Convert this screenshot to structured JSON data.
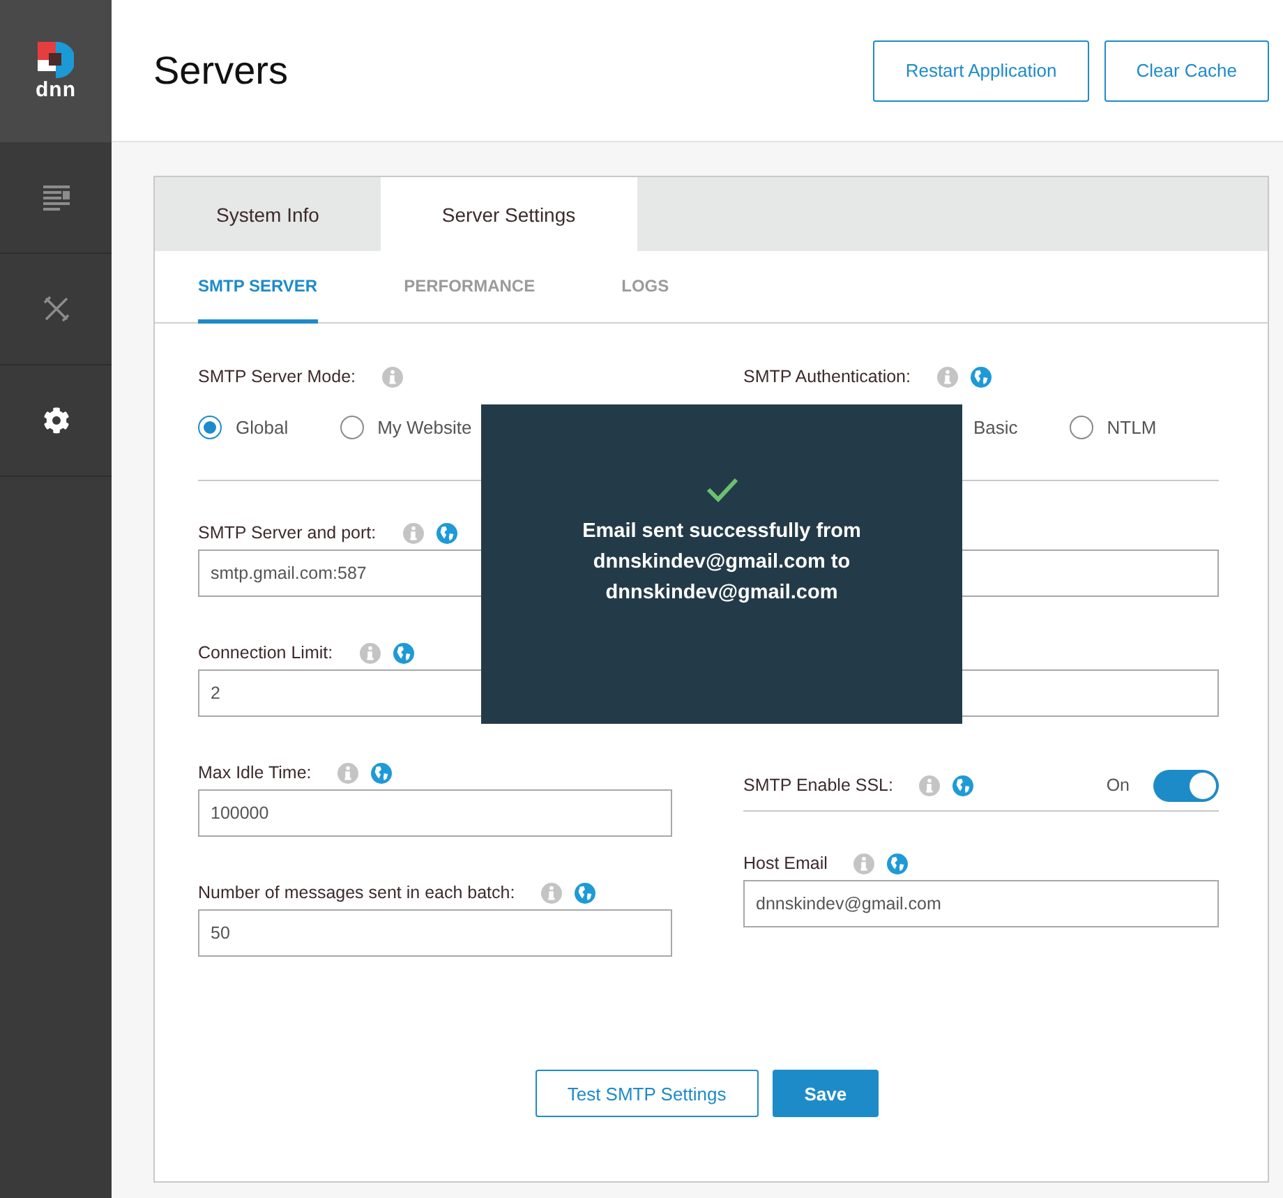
{
  "sidebar": {
    "logo_text": "dnn",
    "items": [
      {
        "kind": "pages",
        "selected": false
      },
      {
        "kind": "tools",
        "selected": false
      },
      {
        "kind": "settings",
        "selected": true
      }
    ]
  },
  "header": {
    "title": "Servers",
    "buttons": [
      "Restart Application",
      "Clear Cache"
    ]
  },
  "tabs": [
    {
      "label": "System Info",
      "selected": false
    },
    {
      "label": "Server Settings",
      "selected": true
    }
  ],
  "subtabs": [
    {
      "label": "SMTP SERVER",
      "selected": true
    },
    {
      "label": "PERFORMANCE",
      "selected": false
    },
    {
      "label": "LOGS",
      "selected": false
    }
  ],
  "left_fields": [
    {
      "kind": "radio",
      "label": "SMTP Server Mode:",
      "globe": false,
      "options": [
        {
          "label": "Global",
          "selected": true
        },
        {
          "label": "My Website",
          "selected": false
        }
      ]
    },
    {
      "kind": "text",
      "label": "SMTP Server and port:",
      "globe": true,
      "value": "smtp.gmail.com:587"
    },
    {
      "kind": "text",
      "label": "Connection Limit:",
      "globe": true,
      "value": "2"
    },
    {
      "kind": "text",
      "label": "Max Idle Time:",
      "globe": true,
      "value": "100000"
    },
    {
      "kind": "text",
      "label": "Number of messages sent in each batch:",
      "globe": true,
      "value": "50"
    }
  ],
  "right_fields": [
    {
      "kind": "radio",
      "label": "SMTP Authentication:",
      "globe": true,
      "options": [
        {
          "label": "Basic"
        },
        {
          "label": "NTLM",
          "selected": false
        }
      ]
    },
    {
      "kind": "text"
    },
    {
      "kind": "text"
    },
    {
      "kind": "toggle",
      "label": "SMTP Enable SSL:",
      "globe": true,
      "state_text": "On",
      "on": true
    },
    {
      "kind": "text",
      "label": "Host Email",
      "globe": true,
      "value": "dnnskindev@gmail.com"
    }
  ],
  "actions": [
    {
      "label": "Test SMTP Settings",
      "kind": "secondary"
    },
    {
      "label": "Save",
      "kind": "primary"
    }
  ],
  "toast": {
    "message": "Email sent successfully from dnnskindev@gmail.com to dnnskindev@gmail.com"
  }
}
